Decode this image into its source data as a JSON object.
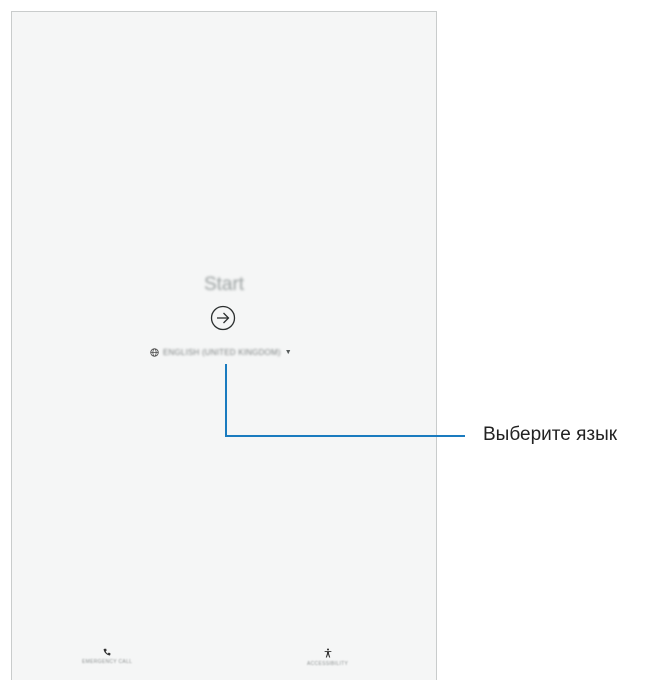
{
  "screen": {
    "title": "Start",
    "start_button_icon": "arrow-right-circle-icon",
    "language": {
      "icon": "globe-icon",
      "label": "ENGLISH (UNITED KINGDOM)",
      "dropdown_icon": "caret-down-icon"
    },
    "bottom_actions": [
      {
        "label": "EMERGENCY CALL",
        "icon": "phone-icon"
      },
      {
        "label": "ACCESSIBILITY",
        "icon": "accessibility-icon"
      }
    ]
  },
  "callout": {
    "text": "Выберите язык",
    "color": "#1a7bbf"
  }
}
